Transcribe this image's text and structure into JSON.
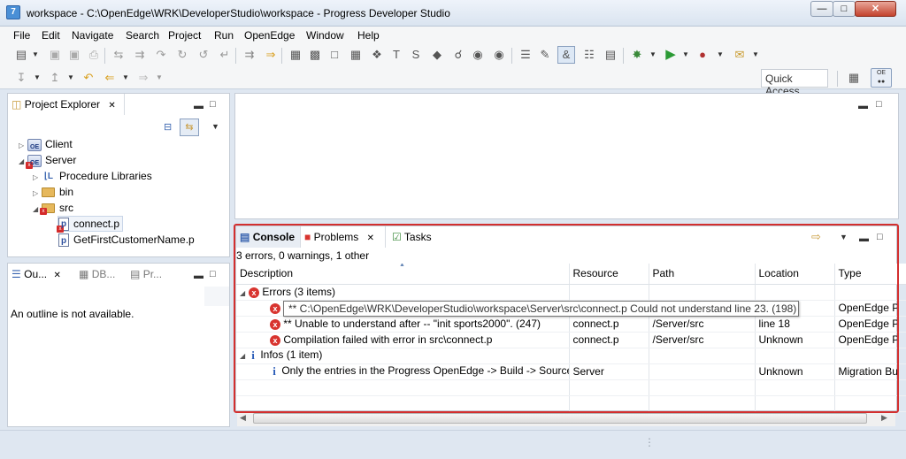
{
  "window": {
    "title": "workspace - C:\\OpenEdge\\WRK\\DeveloperStudio\\workspace - Progress Developer Studio",
    "buttons": [
      "minimize",
      "maximize",
      "close"
    ]
  },
  "menu": [
    "File",
    "Edit",
    "Navigate",
    "Search",
    "Project",
    "Run",
    "OpenEdge",
    "Window",
    "Help"
  ],
  "quick_access": {
    "placeholder": "Quick Access"
  },
  "project_explorer": {
    "tab_label": "Project Explorer",
    "tree": [
      {
        "label": "Client",
        "level": 0,
        "expanded": false,
        "icon": "openedge-project-icon"
      },
      {
        "label": "Server",
        "level": 0,
        "expanded": true,
        "icon": "openedge-project-error-icon"
      },
      {
        "label": "Procedure Libraries",
        "level": 1,
        "expanded": false,
        "icon": "procedure-library-icon"
      },
      {
        "label": "bin",
        "level": 1,
        "expanded": false,
        "icon": "folder-icon"
      },
      {
        "label": "src",
        "level": 1,
        "expanded": true,
        "icon": "folder-error-icon"
      },
      {
        "label": "connect.p",
        "level": 2,
        "icon": "procedure-file-error-icon",
        "selected": true
      },
      {
        "label": "GetFirstCustomerName.p",
        "level": 2,
        "icon": "procedure-file-icon"
      }
    ]
  },
  "outline": {
    "tabs": [
      "Ou...",
      "DB...",
      "Pr..."
    ],
    "message": "An outline is not available."
  },
  "bottom_views": {
    "tabs": [
      "Console",
      "Problems",
      "Tasks"
    ],
    "summary": "3 errors, 0 warnings, 1 other",
    "columns": [
      "Description",
      "Resource",
      "Path",
      "Location",
      "Type"
    ],
    "rows": [
      {
        "kind": "group",
        "icon": "error",
        "description": "Errors (3 items)"
      },
      {
        "kind": "error",
        "description": "** C:\\OpenEdge\\WRK\\DeveloperStudio\\workspace\\Server\\src\\connect.p Could not understand line 23. (198)",
        "resource": "",
        "path": "",
        "location": "",
        "type": "OpenEdge P"
      },
      {
        "kind": "error",
        "description": "** Unable to understand after -- \"init sports2000\". (247)",
        "resource": "connect.p",
        "path": "/Server/src",
        "location": "line 18",
        "type": "OpenEdge P"
      },
      {
        "kind": "error",
        "description": "Compilation failed with error in src\\connect.p",
        "resource": "connect.p",
        "path": "/Server/src",
        "location": "Unknown",
        "type": "OpenEdge P"
      },
      {
        "kind": "group",
        "icon": "info",
        "description": "Infos (1 item)"
      },
      {
        "kind": "info",
        "description": "Only the entries in the Progress OpenEdge -> Build -> Source",
        "resource": "Server",
        "path": "",
        "location": "Unknown",
        "type": "Migration Bu"
      }
    ],
    "tooltip": "** C:\\OpenEdge\\WRK\\DeveloperStudio\\workspace\\Server\\src\\connect.p Could not understand line 23. (198)",
    "highlight_color": "#d32f2f"
  }
}
